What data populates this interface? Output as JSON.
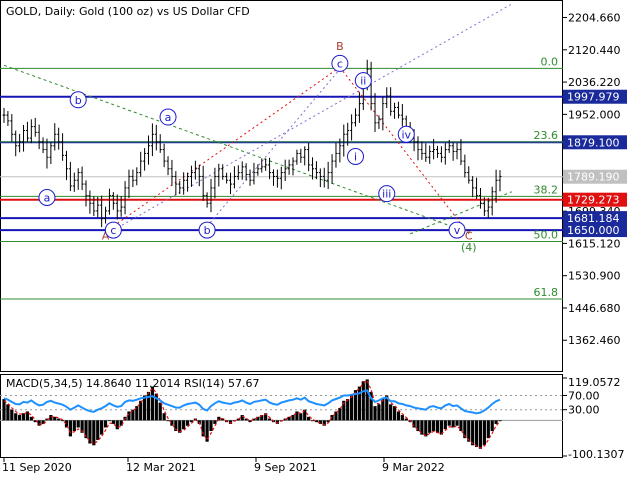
{
  "header": {
    "main": "GOLD, Daily:  Gold (100 oz) vs US Dollar CFD",
    "indicator": "MACD(5,34,5) 14.8640 11.2014 RSI(14) 57.67"
  },
  "colors": {
    "candle": "#000000",
    "blue_line": "#1515b5",
    "red_line": "#e01010",
    "green_fib": "#2e8b2e",
    "wave_major": "#b03a2e",
    "wave_minor": "#1c1ccc",
    "wave_label_green": "#2e8b2e",
    "label_blue_bg": "#1a2a9a",
    "label_red_bg": "#e01010",
    "label_grey_bg": "#c0c0c0",
    "macd_hist": "#000000",
    "rsi": "#1e90ff",
    "macd_signal": "#e01010"
  },
  "chart_data": [
    {
      "type": "line",
      "panel": "price",
      "x_axis_labels": [
        "11 Sep 2020",
        "12 Mar 2021",
        "9 Sep 2021",
        "9 Mar 2022"
      ],
      "y_ticks": [
        2204.66,
        2120.44,
        2036.22,
        1952.0,
        1867.78,
        1783.56,
        1699.34,
        1615.12,
        1530.9,
        1446.68,
        1362.46
      ],
      "y_tick_labels": [
        "2204.660",
        "2120.440",
        "2036.220",
        "1952.000",
        "1783.560",
        "1699.340",
        "1615.120",
        "1530.900",
        "1446.680",
        "1362.460"
      ],
      "ylim": [
        1290,
        2240
      ],
      "series": [
        {
          "values": [
            1950,
            1935,
            1900,
            1870,
            1880,
            1910,
            1890,
            1920,
            1905,
            1880,
            1860,
            1840,
            1870,
            1900,
            1880,
            1845,
            1810,
            1765,
            1780,
            1800,
            1770,
            1740,
            1720,
            1700,
            1715,
            1680,
            1700,
            1740,
            1720,
            1700,
            1710,
            1760,
            1790,
            1780,
            1800,
            1830,
            1850,
            1870,
            1900,
            1880,
            1860,
            1830,
            1810,
            1790,
            1770,
            1760,
            1780,
            1790,
            1800,
            1810,
            1790,
            1740,
            1720,
            1760,
            1790,
            1810,
            1790,
            1780,
            1770,
            1790,
            1800,
            1815,
            1795,
            1780,
            1800,
            1810,
            1815,
            1820,
            1800,
            1790,
            1785,
            1800,
            1810,
            1820,
            1830,
            1850,
            1840,
            1860,
            1820,
            1810,
            1800,
            1790,
            1780,
            1800,
            1830,
            1850,
            1870,
            1900,
            1910,
            1930,
            1950,
            1980,
            2040,
            2070,
            1980,
            1930,
            1940,
            1980,
            2000,
            1960,
            1970,
            1950,
            1940,
            1920,
            1900,
            1880,
            1860,
            1850,
            1840,
            1855,
            1860,
            1850,
            1840,
            1860,
            1870,
            1855,
            1860,
            1830,
            1800,
            1780,
            1760,
            1740,
            1720,
            1700,
            1710,
            1750,
            1780,
            1790
          ]
        }
      ],
      "horizontal_levels": [
        {
          "price": 1997.979,
          "label": "1997.979",
          "style": "blue"
        },
        {
          "price": 1879.1,
          "label": "1879.100",
          "style": "blue"
        },
        {
          "price": 1789.19,
          "label": "1789.190",
          "style": "grey"
        },
        {
          "price": 1729.273,
          "label": "1729.273",
          "style": "red"
        },
        {
          "price": 1681.184,
          "label": "1681.184",
          "style": "blue"
        },
        {
          "price": 1650.0,
          "label": "1650.000",
          "style": "blue"
        }
      ],
      "fib_levels": [
        {
          "price": 2072,
          "label": "0.0"
        },
        {
          "price": 1880,
          "label": "23.6"
        },
        {
          "price": 1738,
          "label": "38.2"
        },
        {
          "price": 1620,
          "label": "50.0"
        },
        {
          "price": 1470,
          "label": "61.8"
        }
      ],
      "wave_labels": {
        "major": [
          {
            "text": "A",
            "index": 26,
            "price": 1625,
            "color": "wave_major"
          },
          {
            "text": "B",
            "index": 86,
            "price": 2120,
            "color": "wave_major"
          },
          {
            "text": "C",
            "index": 119,
            "price": 1625,
            "color": "wave_major"
          },
          {
            "text": "(4)",
            "index": 119,
            "price": 1595,
            "color": "wave_label_green"
          }
        ],
        "minor": [
          {
            "text": "a",
            "index": 11,
            "price": 1735,
            "style": "circle"
          },
          {
            "text": "b",
            "index": 19,
            "price": 1990,
            "style": "circle"
          },
          {
            "text": "c",
            "index": 28,
            "price": 1650,
            "style": "circle"
          },
          {
            "text": "a",
            "index": 42,
            "price": 1945,
            "style": "circle"
          },
          {
            "text": "b",
            "index": 52,
            "price": 1650,
            "style": "circle"
          },
          {
            "text": "c",
            "index": 86,
            "price": 2085,
            "style": "circle"
          },
          {
            "text": "ii",
            "index": 92,
            "price": 2040,
            "style": "circle"
          },
          {
            "text": "i",
            "index": 90,
            "price": 1842,
            "style": "circle"
          },
          {
            "text": "iii",
            "index": 98,
            "price": 1745,
            "style": "circle"
          },
          {
            "text": "iv",
            "index": 103,
            "price": 1900,
            "style": "circle"
          },
          {
            "text": "v",
            "index": 116,
            "price": 1650,
            "style": "circle"
          }
        ]
      },
      "trendlines": [
        {
          "from": {
            "index": 0,
            "price": 2080
          },
          "to": {
            "index": 120,
            "price": 1640
          },
          "style": "green-dotted"
        },
        {
          "from": {
            "index": 104,
            "price": 1640
          },
          "to": {
            "index": 130,
            "price": 1750
          },
          "style": "green-dotted"
        },
        {
          "from": {
            "index": 28,
            "price": 1650
          },
          "to": {
            "index": 130,
            "price": 2240
          },
          "style": "purple-dotted"
        },
        {
          "from": {
            "index": 28,
            "price": 1660
          },
          "to": {
            "index": 86,
            "price": 2075
          },
          "style": "red-dotted"
        },
        {
          "from": {
            "index": 86,
            "price": 2075
          },
          "to": {
            "index": 119,
            "price": 1640
          },
          "style": "red-dotted"
        },
        {
          "from": {
            "index": 52,
            "price": 1660
          },
          "to": {
            "index": 86,
            "price": 2070
          },
          "style": "purple-dotted"
        }
      ]
    },
    {
      "type": "bar",
      "panel": "indicator",
      "y_tick_labels": [
        "119.0572",
        "70.00",
        "30.00",
        "-100.1307"
      ],
      "ylim": [
        -100.1307,
        119.0572
      ],
      "reference_levels": [
        70,
        30
      ],
      "macd_histogram": [
        60,
        45,
        30,
        20,
        15,
        20,
        25,
        10,
        -5,
        -15,
        -10,
        5,
        15,
        10,
        5,
        0,
        -20,
        -45,
        -30,
        -20,
        -35,
        -50,
        -65,
        -70,
        -55,
        -40,
        -20,
        0,
        -10,
        -25,
        -15,
        10,
        25,
        30,
        40,
        55,
        70,
        80,
        95,
        75,
        50,
        20,
        0,
        -15,
        -30,
        -35,
        -25,
        -15,
        -5,
        5,
        -10,
        -45,
        -60,
        -30,
        -10,
        10,
        5,
        -5,
        -10,
        0,
        5,
        15,
        5,
        -5,
        5,
        10,
        15,
        20,
        5,
        -5,
        -10,
        0,
        5,
        10,
        15,
        25,
        20,
        30,
        10,
        0,
        -5,
        -10,
        -15,
        -5,
        15,
        25,
        35,
        55,
        60,
        70,
        85,
        95,
        110,
        115,
        80,
        40,
        45,
        60,
        70,
        45,
        40,
        25,
        15,
        5,
        -5,
        -20,
        -30,
        -40,
        -45,
        -35,
        -30,
        -35,
        -40,
        -25,
        -15,
        -20,
        -15,
        -30,
        -50,
        -60,
        -70,
        -75,
        -80,
        -70,
        -50,
        -30,
        -10,
        0
      ],
      "signal": [
        55,
        48,
        35,
        25,
        18,
        18,
        22,
        15,
        2,
        -10,
        -12,
        0,
        10,
        10,
        7,
        2,
        -12,
        -35,
        -32,
        -24,
        -30,
        -45,
        -58,
        -66,
        -58,
        -45,
        -28,
        -8,
        -9,
        -20,
        -17,
        4,
        20,
        27,
        36,
        50,
        64,
        76,
        90,
        78,
        56,
        28,
        6,
        -10,
        -25,
        -32,
        -28,
        -18,
        -8,
        2,
        -6,
        -38,
        -54,
        -36,
        -16,
        5,
        5,
        -2,
        -8,
        -2,
        3,
        12,
        6,
        -2,
        3,
        8,
        13,
        18,
        8,
        -2,
        -8,
        -2,
        3,
        8,
        13,
        22,
        20,
        27,
        13,
        3,
        -3,
        -8,
        -12,
        -7,
        10,
        21,
        31,
        49,
        57,
        66,
        80,
        90,
        104,
        112,
        86,
        50,
        46,
        56,
        66,
        50,
        42,
        29,
        18,
        8,
        -2,
        -16,
        -26,
        -36,
        -43,
        -37,
        -31,
        -34,
        -38,
        -28,
        -18,
        -19,
        -16,
        -26,
        -44,
        -55,
        -65,
        -72,
        -78,
        -72,
        -55,
        -36,
        -15,
        -3
      ],
      "rsi": [
        62,
        58,
        52,
        46,
        45,
        52,
        50,
        56,
        48,
        42,
        44,
        52,
        55,
        50,
        47,
        44,
        38,
        30,
        36,
        42,
        36,
        30,
        26,
        24,
        30,
        34,
        40,
        48,
        42,
        38,
        40,
        52,
        56,
        55,
        58,
        62,
        64,
        66,
        68,
        62,
        56,
        48,
        44,
        40,
        36,
        36,
        42,
        46,
        48,
        50,
        44,
        32,
        28,
        40,
        48,
        54,
        50,
        48,
        46,
        50,
        52,
        56,
        50,
        46,
        52,
        54,
        56,
        58,
        50,
        46,
        44,
        50,
        53,
        56,
        58,
        62,
        58,
        64,
        54,
        50,
        46,
        44,
        42,
        48,
        56,
        60,
        64,
        70,
        70,
        72,
        74,
        76,
        82,
        84,
        62,
        52,
        56,
        62,
        64,
        54,
        54,
        48,
        46,
        42,
        40,
        36,
        34,
        32,
        30,
        38,
        40,
        36,
        34,
        42,
        46,
        40,
        42,
        34,
        26,
        24,
        22,
        20,
        22,
        28,
        36,
        46,
        54,
        58
      ],
      "series": [
        {
          "name": "MACD(5,34,5)"
        },
        {
          "name": "RSI(14)"
        }
      ]
    }
  ]
}
